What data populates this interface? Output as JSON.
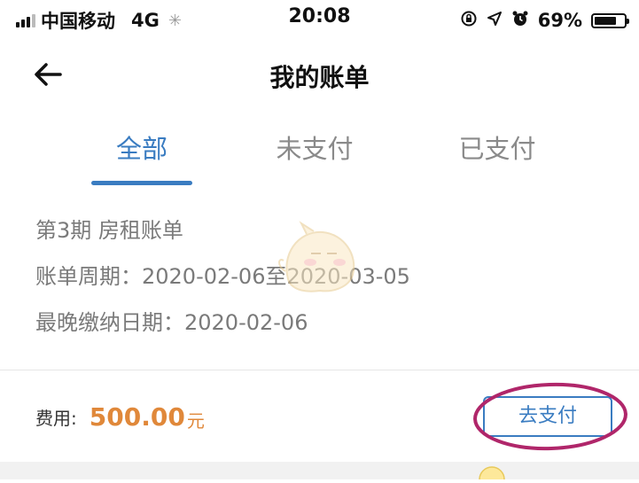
{
  "status_bar": {
    "carrier": "中国移动",
    "network": "4G",
    "time": "20:08",
    "battery_percent": "69%",
    "battery_level": 0.69,
    "icons": [
      "signal-icon",
      "loading-icon",
      "rotation-lock-icon",
      "location-icon",
      "alarm-icon",
      "battery-icon"
    ]
  },
  "nav": {
    "title": "我的账单",
    "back_icon": "back-arrow-icon"
  },
  "tabs": [
    {
      "label": "全部",
      "active": true
    },
    {
      "label": "未支付",
      "active": false
    },
    {
      "label": "已支付",
      "active": false
    }
  ],
  "bill": {
    "title": "第3期 房租账单",
    "period": "账单周期：2020-02-06至2020-03-05",
    "due_date": "最晚缴纳日期：2020-02-06",
    "fee_label": "费用:",
    "fee_amount": "500.00",
    "fee_unit": "元",
    "pay_button": "去支付"
  },
  "colors": {
    "accent": "#3a7cc1",
    "amount": "#e0883a",
    "annotation": "#b0266a"
  }
}
